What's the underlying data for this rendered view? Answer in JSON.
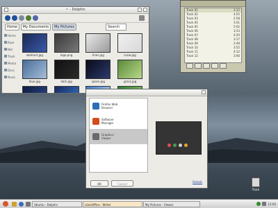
{
  "file_manager": {
    "title": "~ - Dolphin",
    "breadcrumbs": [
      "Home",
      "My Documents",
      "My Pictures"
    ],
    "search": {
      "placeholder": "Search"
    },
    "sidebar": [
      "Home",
      "Root",
      "Net",
      "Trash",
      "Media",
      "Docs",
      "Music"
    ],
    "files": [
      {
        "name": "abstract.jpg",
        "colors": [
          "#1b2a55",
          "#3a59a8"
        ]
      },
      {
        "name": "logo.png",
        "colors": [
          "#3b3b3b",
          "#777"
        ]
      },
      {
        "name": "lines.jpg",
        "colors": [
          "#e9e9e9",
          "#9a9a9a"
        ]
      },
      {
        "name": "snow.jpg",
        "colors": [
          "#f0f0f0",
          "#d8d8d8"
        ]
      },
      {
        "name": "blue.jpg",
        "colors": [
          "#4a6d9a",
          "#a6bed7"
        ]
      },
      {
        "name": "dark.jpg",
        "colors": [
          "#111",
          "#2a2a2a"
        ]
      },
      {
        "name": "space.jpg",
        "colors": [
          "#0a0a1a",
          "#2b3b6b"
        ]
      },
      {
        "name": "grass.jpg",
        "colors": [
          "#5b8a3a",
          "#b9d98a"
        ]
      },
      {
        "name": "deep.jpg",
        "colors": [
          "#0e1c42",
          "#2e4a8f"
        ]
      },
      {
        "name": "wave.jpg",
        "colors": [
          "#152a5c",
          "#3a7bd0"
        ]
      },
      {
        "name": "sky.jpg",
        "colors": [
          "#3b7ac7",
          "#cfe3ff"
        ]
      },
      {
        "name": "green.jpg",
        "colors": [
          "#2f7f2f",
          "#9bd46b"
        ]
      }
    ]
  },
  "media_player": {
    "playlist": [
      {
        "title": "Track 01",
        "time": "3:12"
      },
      {
        "title": "Track 02",
        "time": "4:05"
      },
      {
        "title": "Track 03",
        "time": "2:58"
      },
      {
        "title": "Track 04",
        "time": "3:41"
      },
      {
        "title": "Track 05",
        "time": "5:02"
      },
      {
        "title": "Track 06",
        "time": "3:33"
      },
      {
        "title": "Track 07",
        "time": "4:20"
      },
      {
        "title": "Track 08",
        "time": "3:17"
      },
      {
        "title": "Track 09",
        "time": "2:49"
      },
      {
        "title": "Track 10",
        "time": "3:55"
      },
      {
        "title": "Track 11",
        "time": "4:12"
      },
      {
        "title": "Track 12",
        "time": "3:06"
      }
    ],
    "selected_index": 0
  },
  "dialog": {
    "items": [
      {
        "title": "Firefox Web",
        "subtitle": "Browser",
        "icon_color": "#2d6fb6"
      },
      {
        "title": "Software",
        "subtitle": "Manager",
        "icon_color": "#d44c1c"
      },
      {
        "title": "Graphics",
        "subtitle": "Viewer",
        "icon_color": "#6a6a6a"
      }
    ],
    "selected_index": 2,
    "preview_dots": [
      "#e14c4c",
      "#44a04d",
      "#cfcfcf",
      "#e8a32b"
    ],
    "buttons": {
      "ok": "OK",
      "cancel": "Cancel"
    },
    "link": "Details"
  },
  "taskbar": {
    "start_label": "Start",
    "tasks": [
      "Ubuntu - Dolphin",
      "LibreOffice - Writer",
      "My Pictures - Viewer"
    ],
    "clock": "12:00"
  },
  "desktop": {
    "trash_label": "Trash"
  }
}
